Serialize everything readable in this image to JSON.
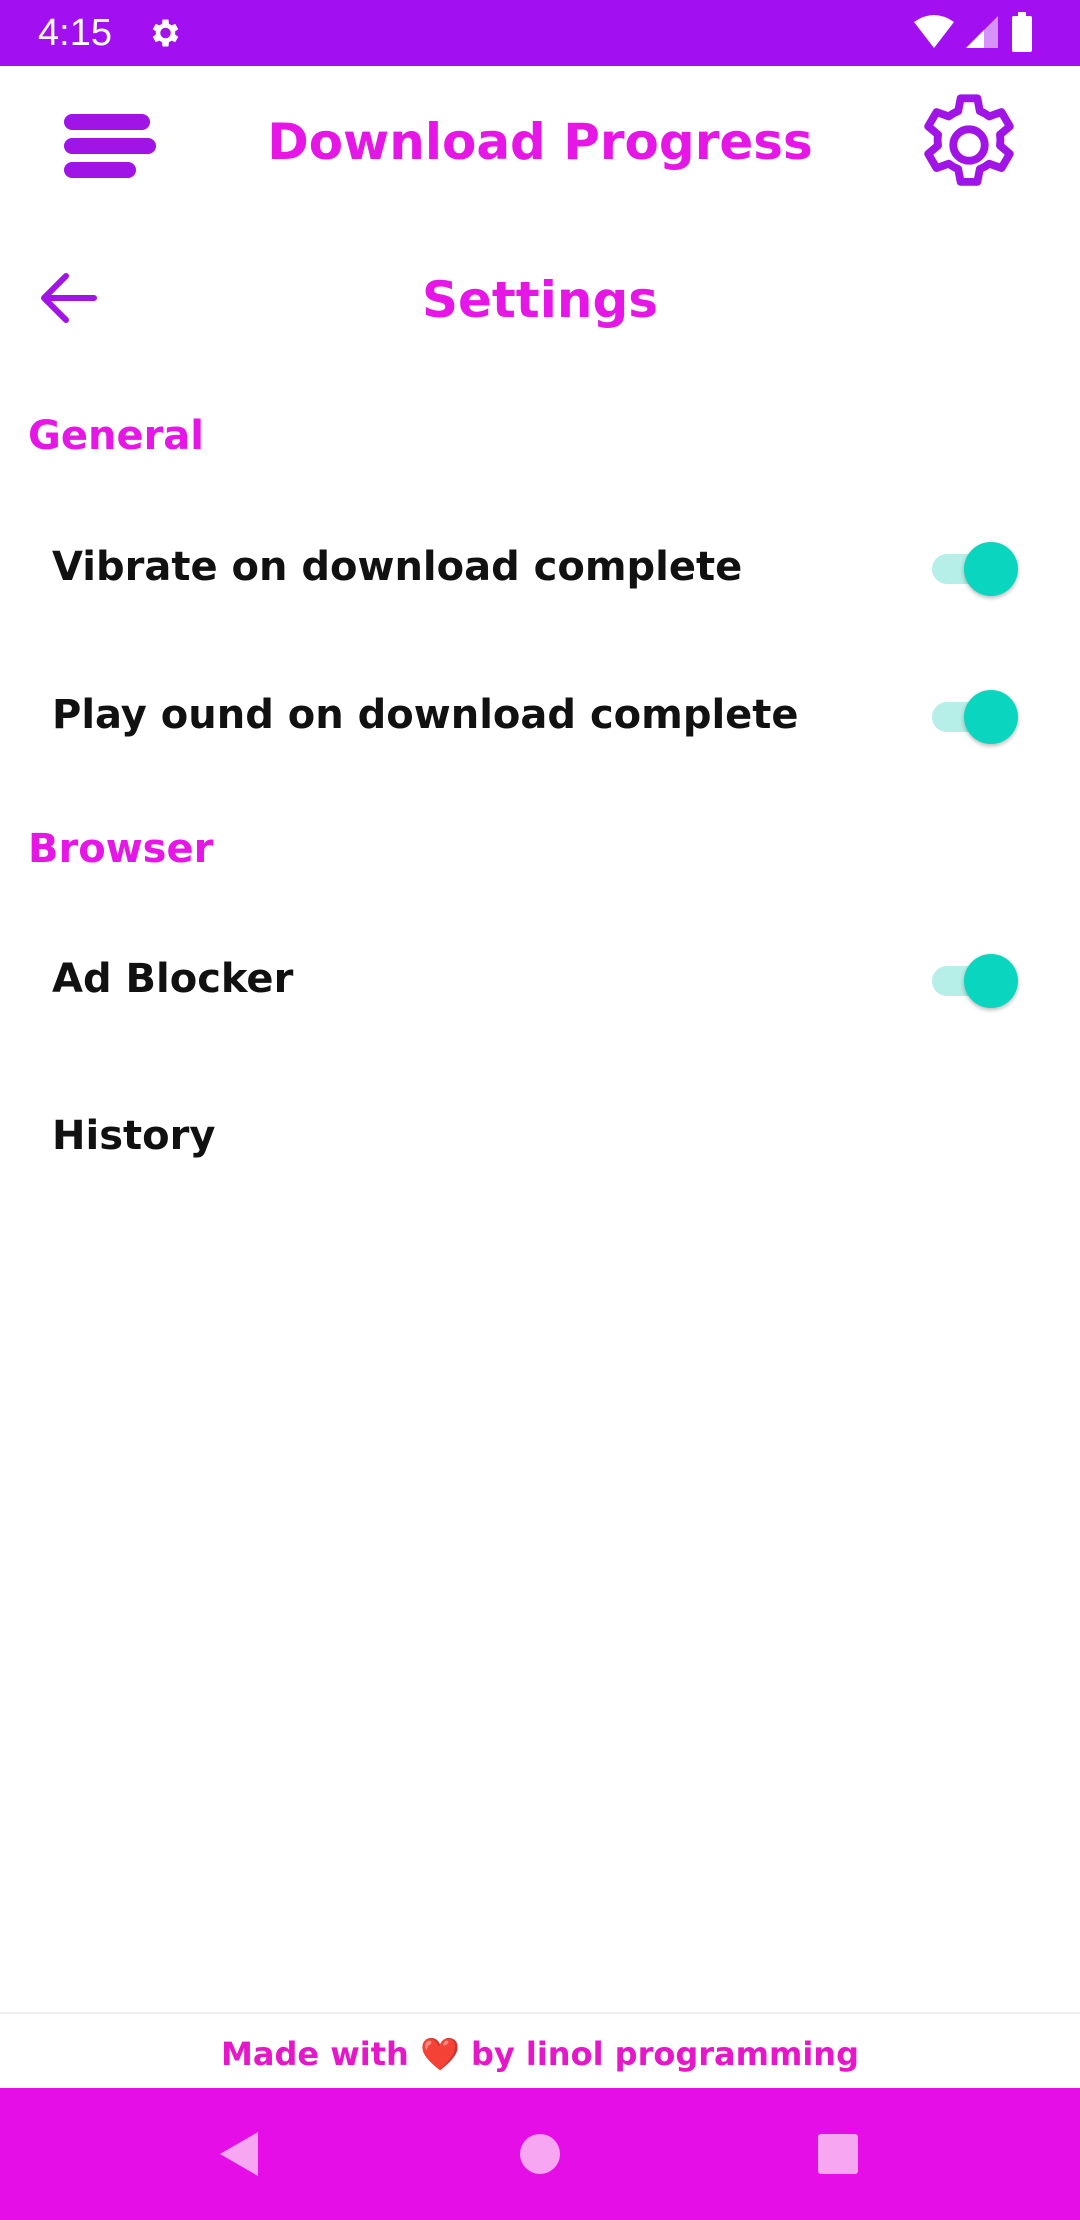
{
  "status_bar": {
    "time": "4:15",
    "icons": [
      "settings-gear-icon",
      "wifi-icon",
      "signal-icon",
      "battery-icon"
    ],
    "background": "#a20ff0"
  },
  "app_bar": {
    "title": "Download Progress",
    "left_icon": "menu-icon",
    "right_icon": "gear-icon",
    "accent": "#e617e6"
  },
  "sub_header": {
    "back_icon": "arrow-left-icon",
    "title": "Settings"
  },
  "sections": [
    {
      "header": "General",
      "items": [
        {
          "label": "Vibrate on download complete",
          "switch": true
        },
        {
          "label": "Play ound on download complete",
          "switch": true
        }
      ]
    },
    {
      "header": "Browser",
      "items": [
        {
          "label": "Ad Blocker",
          "switch": true
        },
        {
          "label": "History"
        }
      ]
    }
  ],
  "footer": {
    "before": "Made with",
    "heart": "❤️",
    "after": "by linol programming"
  },
  "nav_bar": {
    "background": "#e60ee6",
    "buttons": [
      "back-triangle-icon",
      "home-circle-icon",
      "recents-square-icon"
    ]
  },
  "colors": {
    "switch_thumb": "#0ad6c0",
    "switch_track": "#b5efe7"
  }
}
